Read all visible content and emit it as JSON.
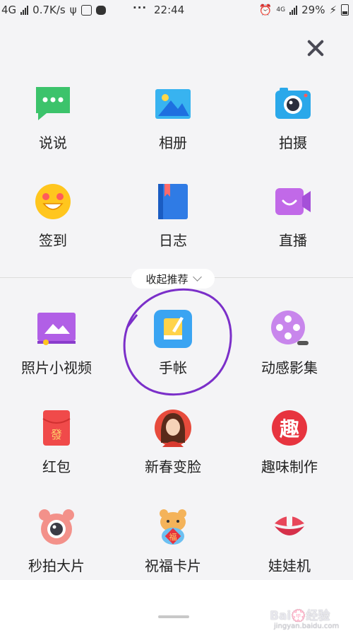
{
  "status_bar": {
    "network": "4G",
    "speed": "0.7K/s",
    "dots": "···",
    "time": "22:44",
    "network_right": "4G",
    "battery": "29%"
  },
  "grid": [
    {
      "label": "说说",
      "icon": "chat-bubble-icon"
    },
    {
      "label": "相册",
      "icon": "photo-album-icon"
    },
    {
      "label": "拍摄",
      "icon": "camera-icon"
    },
    {
      "label": "签到",
      "icon": "smiley-icon"
    },
    {
      "label": "日志",
      "icon": "journal-book-icon"
    },
    {
      "label": "直播",
      "icon": "live-video-icon"
    }
  ],
  "collapse_label": "收起推荐",
  "recommended": [
    {
      "label": "照片小视频",
      "icon": "photo-video-icon"
    },
    {
      "label": "手帐",
      "icon": "notebook-icon"
    },
    {
      "label": "动感影集",
      "icon": "film-reel-icon"
    },
    {
      "label": "红包",
      "icon": "red-packet-icon"
    },
    {
      "label": "新春变脸",
      "icon": "face-avatar-icon"
    },
    {
      "label": "趣味制作",
      "icon": "fun-create-icon"
    },
    {
      "label": "秒拍大片",
      "icon": "bear-camera-icon"
    },
    {
      "label": "祝福卡片",
      "icon": "blessing-card-icon"
    },
    {
      "label": "娃娃机",
      "icon": "claw-machine-icon"
    }
  ],
  "watermark": {
    "main": "Bai💮经验",
    "sub": "jingyan.baidu.com"
  },
  "colors": {
    "annotation": "#7b2fc9",
    "accent_blue": "#2f8cf2",
    "red": "#e7343f"
  }
}
